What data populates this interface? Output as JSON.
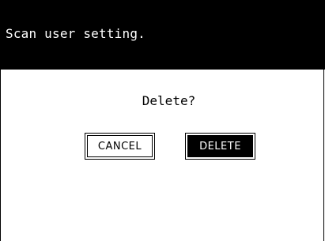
{
  "header": {
    "title": "Scan user setting."
  },
  "dialog": {
    "prompt": "Delete?",
    "cancel_label": "CANCEL",
    "delete_label": "DELETE"
  },
  "colors": {
    "header_background": "#000000",
    "header_text": "#ffffff",
    "body_background": "#ffffff",
    "selected_button_background": "#000000"
  }
}
